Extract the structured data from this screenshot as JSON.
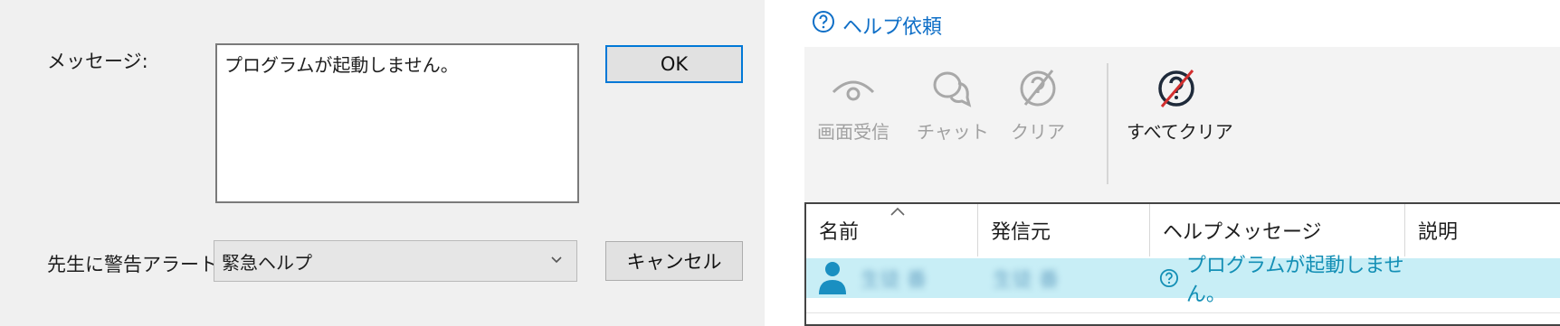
{
  "dialog": {
    "message_label": "メッセージ:",
    "message_value": "プログラムが起動しません。",
    "alert_label": "先生に警告アラート:",
    "alert_selected": "緊急ヘルプ",
    "ok_label": "OK",
    "cancel_label": "キャンセル"
  },
  "panel": {
    "title": "ヘルプ依頼",
    "toolbar": [
      {
        "label": "画面受信",
        "icon": "eye-icon",
        "enabled": false
      },
      {
        "label": "チャット",
        "icon": "chat-icon",
        "enabled": false
      },
      {
        "label": "クリア",
        "icon": "clear-icon",
        "enabled": false
      },
      {
        "label": "すべてクリア",
        "icon": "clear-all-icon",
        "enabled": true
      }
    ],
    "columns": [
      "名前",
      "発信元",
      "ヘルプメッセージ",
      "説明"
    ],
    "rows": [
      {
        "name": "生徒 番",
        "source": "生徒 番",
        "message": "プログラムが起動しません。",
        "description": ""
      }
    ]
  },
  "colors": {
    "accent": "#0078d7",
    "title": "#0f6fc7",
    "selected_row": "#c8eef6",
    "user_icon": "#1a8fc1",
    "clear_all_slash": "#d32f2f"
  }
}
